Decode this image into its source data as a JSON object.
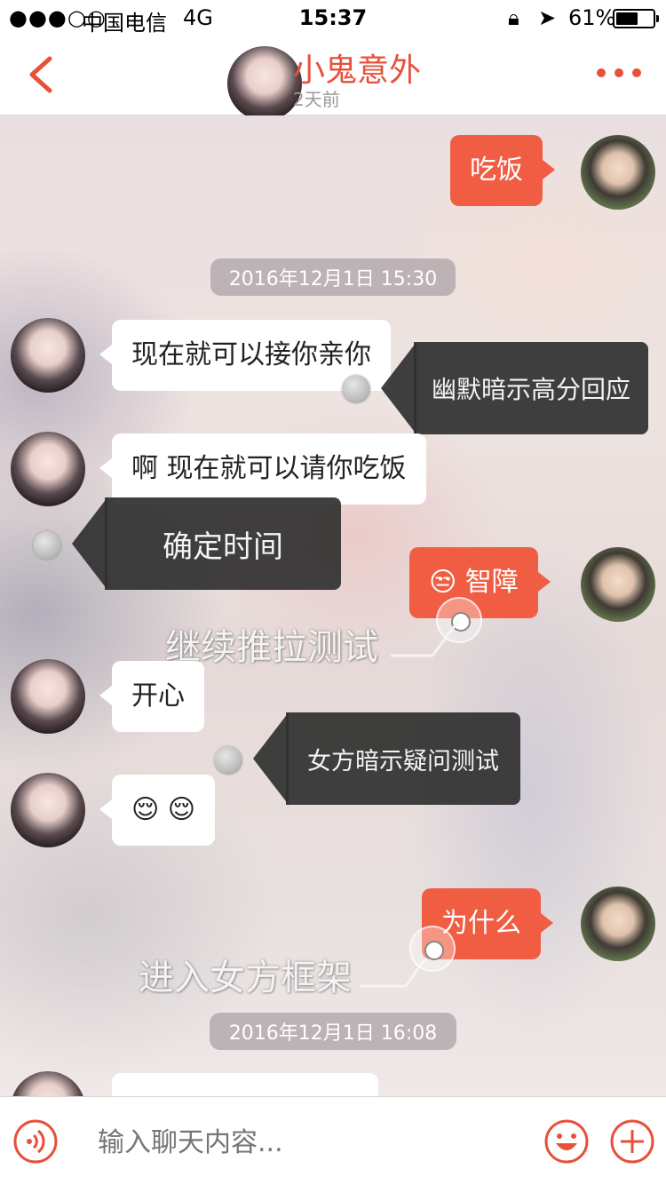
{
  "status_bar": {
    "signal": "●●●○○",
    "carrier": "中国电信",
    "network": "4G",
    "time": "15:37",
    "battery_percent": "61%",
    "battery_level": 0.61
  },
  "header": {
    "contact_name": "小鬼意外",
    "last_seen": "2天前",
    "accent_color": "#e8503a"
  },
  "messages": [
    {
      "side": "out",
      "text": "吃饭"
    },
    {
      "type": "timestamp",
      "text": "2016年12月1日 15:30"
    },
    {
      "side": "in",
      "text": "现在就可以接你亲你"
    },
    {
      "side": "in",
      "text": "啊  现在就可以请你吃饭"
    },
    {
      "side": "out",
      "text": "😒 智障"
    },
    {
      "side": "in",
      "text": "开心"
    },
    {
      "side": "in",
      "text": "😌 😌"
    },
    {
      "side": "out",
      "text": "为什么"
    },
    {
      "type": "timestamp",
      "text": "2016年12月1日 16:08"
    }
  ],
  "annotations": {
    "tags": [
      "幽默暗示高分回应",
      "确定时间",
      "女方暗示疑问测试"
    ],
    "labels": [
      "继续推拉测试",
      "进入女方框架"
    ]
  },
  "input_bar": {
    "placeholder": "输入聊天内容..."
  },
  "colors": {
    "outgoing_bubble": "#f05d43",
    "incoming_bubble": "#ffffff",
    "tag_background": "#303030"
  }
}
